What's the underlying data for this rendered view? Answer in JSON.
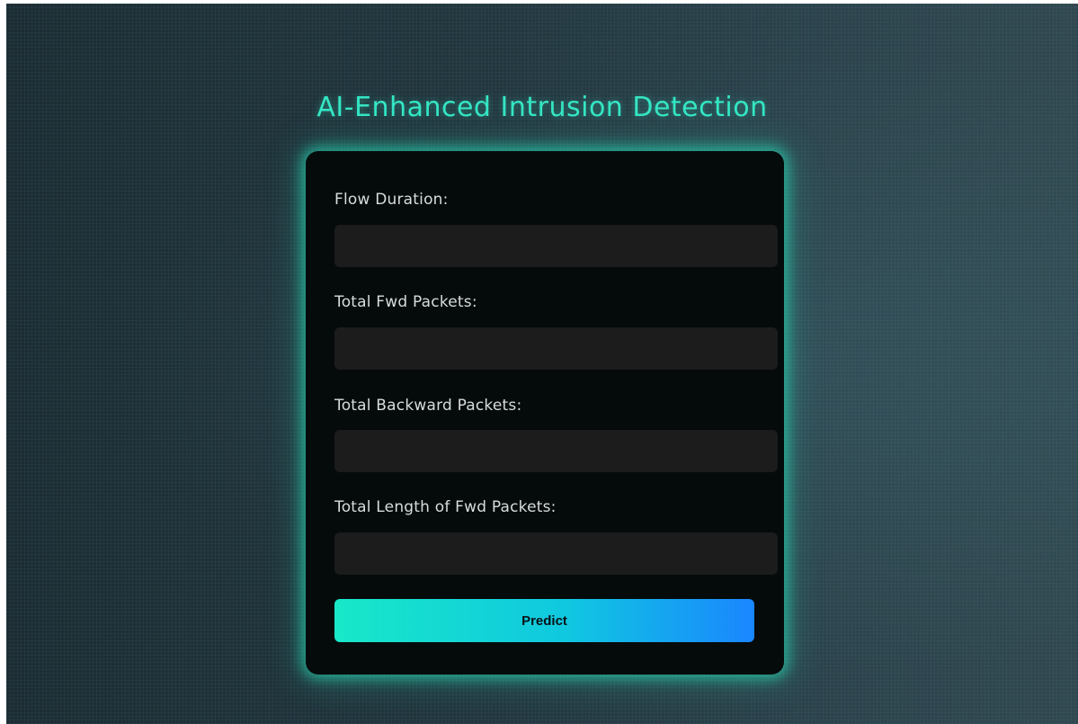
{
  "page": {
    "title": "AI-Enhanced Intrusion Detection"
  },
  "form": {
    "fields": [
      {
        "label": "Flow Duration:",
        "value": "",
        "placeholder": ""
      },
      {
        "label": "Total Fwd Packets:",
        "value": "",
        "placeholder": ""
      },
      {
        "label": "Total Backward Packets:",
        "value": "",
        "placeholder": ""
      },
      {
        "label": "Total Length of Fwd Packets:",
        "value": "",
        "placeholder": ""
      }
    ],
    "submit_label": "Predict"
  },
  "colors": {
    "accent": "#34e6c4",
    "card_background": "#050a0b",
    "input_background": "#1c1c1c",
    "button_gradient_start": "#18e8c8",
    "button_gradient_end": "#1a86ff"
  }
}
